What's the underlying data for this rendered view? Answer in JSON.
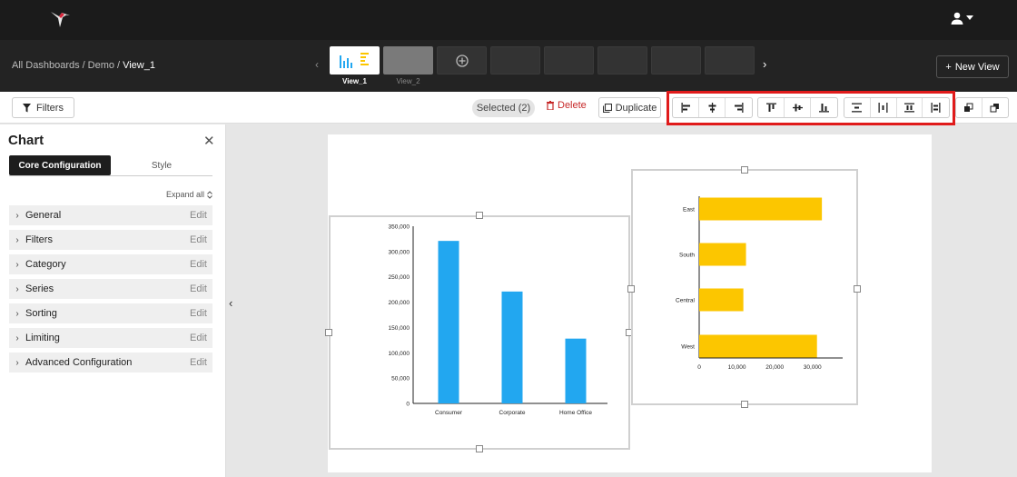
{
  "header": {
    "logo_icon": "hummingbird-logo",
    "user_icon": "user-icon"
  },
  "breadcrumb": {
    "all": "All Dashboards",
    "demo": "Demo",
    "sep": "/",
    "current": "View_1"
  },
  "views": {
    "tabs": [
      {
        "label": "View_1"
      },
      {
        "label": "View_2"
      }
    ],
    "new_view_label": "New View"
  },
  "toolbar": {
    "filters_label": "Filters",
    "selected_label": "Selected (2)",
    "delete_label": "Delete",
    "duplicate_label": "Duplicate",
    "highlight_color": "#e01b1b"
  },
  "sidebar": {
    "title": "Chart",
    "tabs": [
      "Core Configuration",
      "Style"
    ],
    "expand_all": "Expand all",
    "sections": [
      {
        "label": "General",
        "edit": "Edit"
      },
      {
        "label": "Filters",
        "edit": "Edit"
      },
      {
        "label": "Category",
        "edit": "Edit"
      },
      {
        "label": "Series",
        "edit": "Edit"
      },
      {
        "label": "Sorting",
        "edit": "Edit"
      },
      {
        "label": "Limiting",
        "edit": "Edit"
      },
      {
        "label": "Advanced Configuration",
        "edit": "Edit"
      }
    ]
  },
  "chart_data": [
    {
      "type": "bar",
      "orientation": "vertical",
      "categories": [
        "Consumer",
        "Corporate",
        "Home Office"
      ],
      "values": [
        321000,
        221000,
        128000
      ],
      "yticks": [
        "0",
        "50,000",
        "100,000",
        "150,000",
        "200,000",
        "250,000",
        "300,000",
        "350,000"
      ],
      "ylim": [
        0,
        350000
      ],
      "color": "#22a7f0"
    },
    {
      "type": "bar",
      "orientation": "horizontal",
      "categories": [
        "East",
        "South",
        "Central",
        "West"
      ],
      "values": [
        32500,
        12400,
        11700,
        31200
      ],
      "xticks": [
        "0",
        "10,000",
        "20,000",
        "30,000"
      ],
      "xlim": [
        0,
        38000
      ],
      "color": "#fcc600"
    }
  ]
}
